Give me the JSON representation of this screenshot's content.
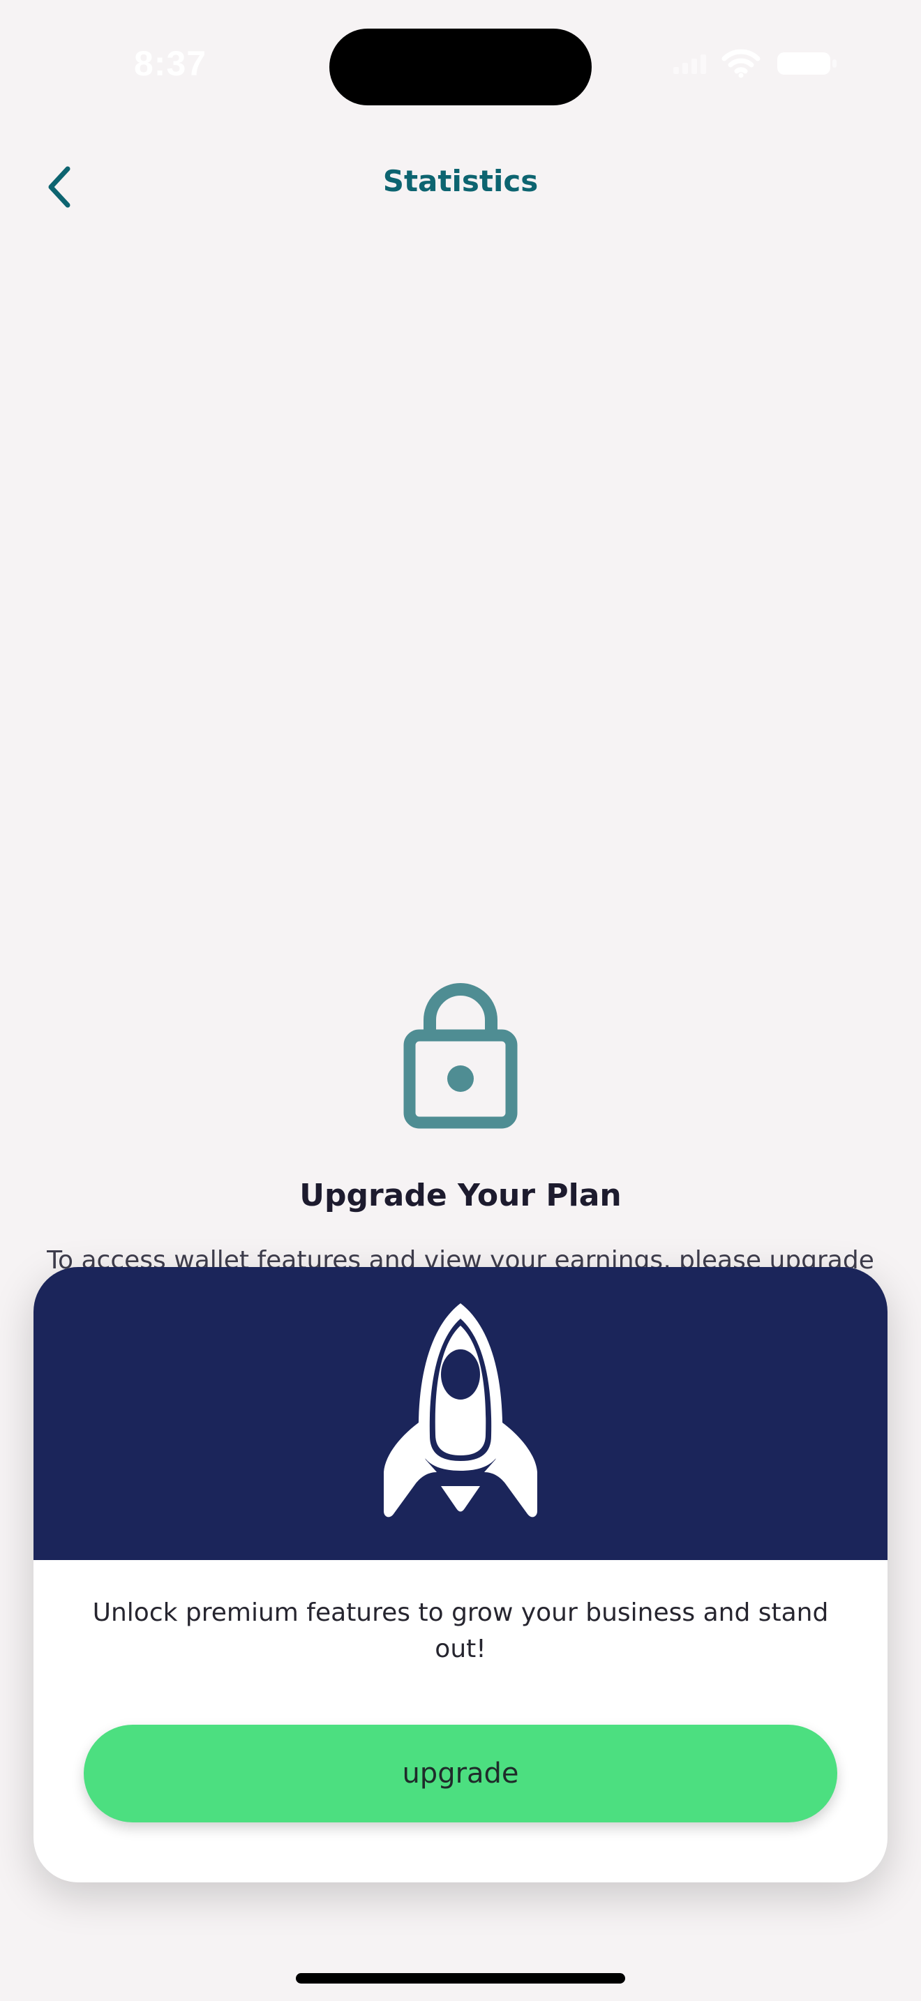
{
  "status_bar": {
    "time": "8:37",
    "wifi_icon": "wifi-icon",
    "battery_icon": "battery-icon",
    "signal_icon": "cellular-signal-icon"
  },
  "nav": {
    "back_icon": "chevron-left-icon",
    "title": "Statistics"
  },
  "locked_state": {
    "icon": "lock-icon",
    "title": "Upgrade Your Plan",
    "description": "To access wallet features and view your earnings, please upgrade"
  },
  "modal": {
    "hero_icon": "rocket-icon",
    "message": "Unlock premium features to grow your business and stand out!",
    "button_label": "upgrade"
  },
  "colors": {
    "background": "#f6f3f4",
    "title_teal": "#0d6470",
    "lock_teal": "#4f8d93",
    "hero_navy": "#1b255a",
    "button_green": "#4cdf80"
  }
}
